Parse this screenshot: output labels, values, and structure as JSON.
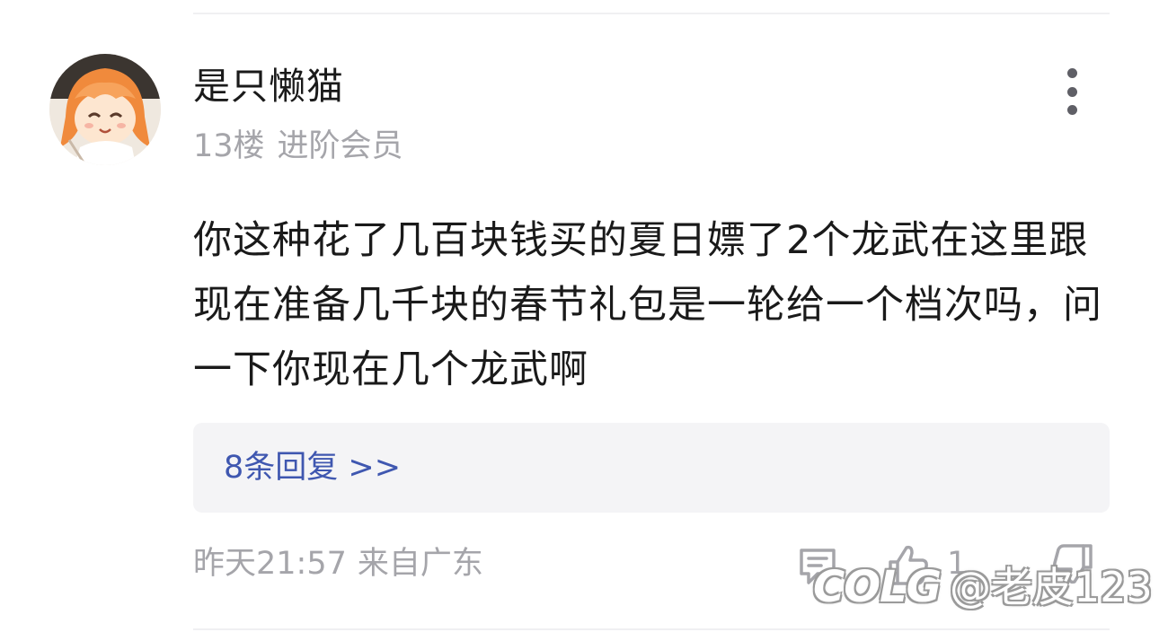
{
  "post": {
    "username": "是只懒猫",
    "floor": "13楼",
    "member_level": "进阶会员",
    "content": "你这种花了几百块钱买的夏日嫖了2个龙武在这里跟现在准备几千块的春节礼包是一轮给一个档次吗，问一下你现在几个龙武啊",
    "replies_label": "8条回复 >>",
    "time": "昨天21:57",
    "location": "来自广东",
    "like_count": "1"
  },
  "watermark": {
    "logo": "COLG",
    "handle": "@老皮123"
  },
  "colors": {
    "link": "#3f57b0",
    "meta": "#a5a5aa",
    "reply_bg": "#f4f4f6",
    "text": "#1a1a1a"
  },
  "icons": [
    "more-vertical-icon",
    "comment-icon",
    "thumbs-up-icon",
    "thumbs-down-icon"
  ]
}
